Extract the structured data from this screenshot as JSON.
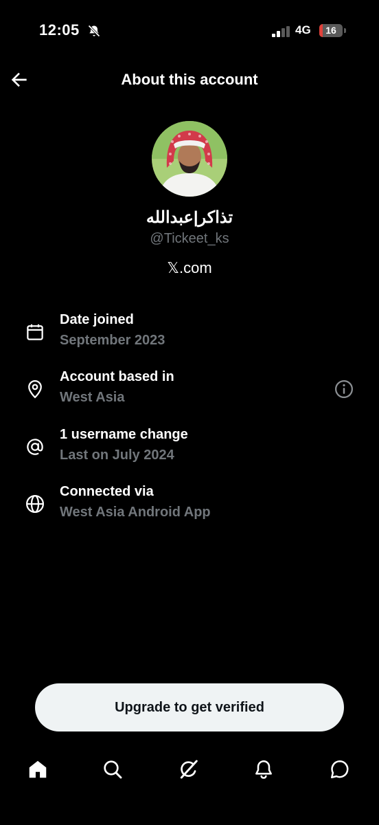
{
  "status_bar": {
    "time": "12:05",
    "network": "4G",
    "battery_percent": "16",
    "battery_level": 0.16,
    "battery_color": "#e0413a",
    "icons": [
      "bell-slash-icon",
      "cellular-signal-icon"
    ]
  },
  "header": {
    "title": "About this account",
    "back_icon": "arrow-left-icon"
  },
  "profile": {
    "display_name": "تذاكر|عبدالله",
    "handle": "@Tickeet_ks",
    "site": "𝕏.com"
  },
  "info": [
    {
      "icon": "calendar-icon",
      "label": "Date joined",
      "value": "September 2023"
    },
    {
      "icon": "location-pin-icon",
      "label": "Account based in",
      "value": "West Asia",
      "extra_icon": "info-icon"
    },
    {
      "icon": "at-sign-icon",
      "label": "1 username change",
      "value": "Last on July 2024"
    },
    {
      "icon": "globe-icon",
      "label": "Connected via",
      "value": "West Asia Android App"
    }
  ],
  "cta": {
    "label": "Upgrade to get verified"
  },
  "tabbar": {
    "items": [
      "home-icon",
      "search-icon",
      "grok-icon",
      "notifications-icon",
      "messages-icon"
    ]
  },
  "colors": {
    "background": "#000000",
    "text_primary": "#ffffff",
    "text_secondary": "#71767b",
    "cta_background": "#eff3f4",
    "cta_text": "#0f1419"
  }
}
